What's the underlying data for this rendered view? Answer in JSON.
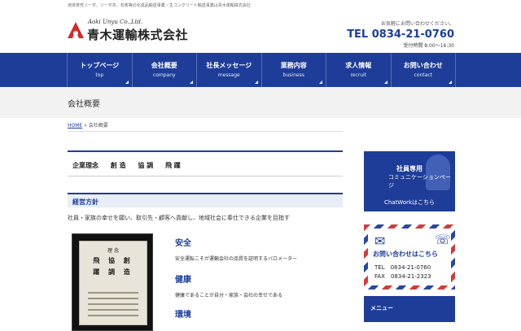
{
  "header": {
    "tagline": "液体苛性ソーダ、ソーダ灰、石炭等の化成品輸送事業・生コンクリート輸送事業は青木運輸株式会社",
    "logo_en": "Aoki Unyu Co.,Ltd.",
    "logo_jp": "青木運輸株式会社",
    "contact_note": "お気軽にお問い合わせください。",
    "tel": "TEL 0834-21-0760",
    "hours": "受付時間 8:00〜16:30"
  },
  "nav": [
    {
      "jp": "トップページ",
      "en": "top"
    },
    {
      "jp": "会社概要",
      "en": "company"
    },
    {
      "jp": "社長メッセージ",
      "en": "message"
    },
    {
      "jp": "業務内容",
      "en": "business"
    },
    {
      "jp": "求人情報",
      "en": "recruit"
    },
    {
      "jp": "お問い合わせ",
      "en": "contact"
    }
  ],
  "page": {
    "title": "会社概要",
    "breadcrumb_home": "HOME",
    "breadcrumb_sep": " » ",
    "breadcrumb_current": "会社概要"
  },
  "main": {
    "philosophy_label": "企業理念",
    "philosophy_words": [
      "創 造",
      "協 調",
      "飛 躍"
    ],
    "policy_heading": "経営方針",
    "policy_text": "社員・家族の幸せを願い、取引先・顧客へ貢献し、地域社会に奉仕できる企業を目指す",
    "photo_title": "理 念",
    "photo_cols": [
      "飛 協 創",
      "躍 調 造"
    ],
    "values": [
      {
        "title": "安全",
        "desc": "安全運転こそが運輸会社の品質を証明するバロメーター"
      },
      {
        "title": "健康",
        "desc": "健康であることが自分・家族・会社の幸せである"
      },
      {
        "title": "環境",
        "desc": ""
      }
    ]
  },
  "sidebar": {
    "chat_label1": "社員専用",
    "chat_label2": "コミュニケーションページ",
    "chat_cta": "ChatWorkはこちら",
    "mail_title": "お問い合わせはこちら",
    "mail_tel": "TEL　0834-21-0760",
    "mail_fax": "FAX　0834-21-2323",
    "menu_heading": "メニュー"
  },
  "colors": {
    "brand": "#1e3d99",
    "accent_red": "#d43a3a"
  },
  "icons": {
    "logo": "aoki-a-logo-icon",
    "mail": "envelope-icon",
    "phone": "phone-icon"
  }
}
